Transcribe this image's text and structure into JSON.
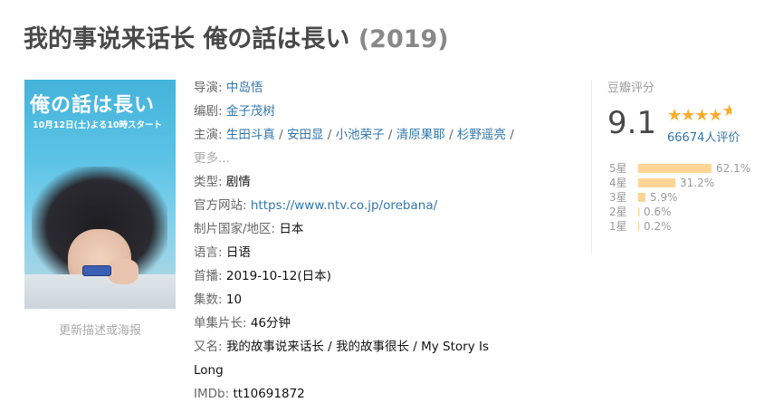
{
  "page": {
    "title_main": "我的事说来话长 俺の話は長い",
    "year": "(2019)"
  },
  "poster": {
    "title_text": "俺の話は長い",
    "subtitle_text": "10月12日(土)よる10時スタート",
    "update_link": "更新描述或海报"
  },
  "info": {
    "director": {
      "label": "导演:",
      "names": [
        "中岛悟"
      ]
    },
    "writer": {
      "label": "编剧:",
      "names": [
        "金子茂树"
      ]
    },
    "cast": {
      "label": "主演:",
      "names": [
        "生田斗真",
        "安田显",
        "小池荣子",
        "清原果耶",
        "杉野遥亮"
      ],
      "separator": " / ",
      "more": "更多..."
    },
    "genre": {
      "label": "类型:",
      "value": "剧情"
    },
    "website": {
      "label": "官方网站:",
      "value": "https://www.ntv.co.jp/orebana/"
    },
    "country": {
      "label": "制片国家/地区:",
      "value": "日本"
    },
    "language": {
      "label": "语言:",
      "value": "日语"
    },
    "premiere": {
      "label": "首播:",
      "value": "2019-10-12(日本)"
    },
    "episodes": {
      "label": "集数:",
      "value": "10"
    },
    "runtime": {
      "label": "单集片长:",
      "value": "46分钟"
    },
    "aka": {
      "label": "又名:",
      "line1": "我的故事说来话长 / 我的故事很长 / My Story Is",
      "line2": "Long"
    },
    "imdb": {
      "label": "IMDb:",
      "value": "tt10691872"
    }
  },
  "rating": {
    "title": "豆瓣评分",
    "score": "9.1",
    "stars_icon": "rating-stars-4.5",
    "votes": "66674人评价",
    "distribution": [
      {
        "label": "5星",
        "percent_text": "62.1%",
        "percent": 62.1
      },
      {
        "label": "4星",
        "percent_text": "31.2%",
        "percent": 31.2
      },
      {
        "label": "3星",
        "percent_text": "5.9%",
        "percent": 5.9
      },
      {
        "label": "2星",
        "percent_text": "0.6%",
        "percent": 0.6
      },
      {
        "label": "1星",
        "percent_text": "0.2%",
        "percent": 0.2
      }
    ]
  },
  "colors": {
    "link": "#3377aa",
    "title": "#494949",
    "star": "#ffac2d",
    "bar": "#ffd596",
    "muted": "#9b9b9b"
  }
}
